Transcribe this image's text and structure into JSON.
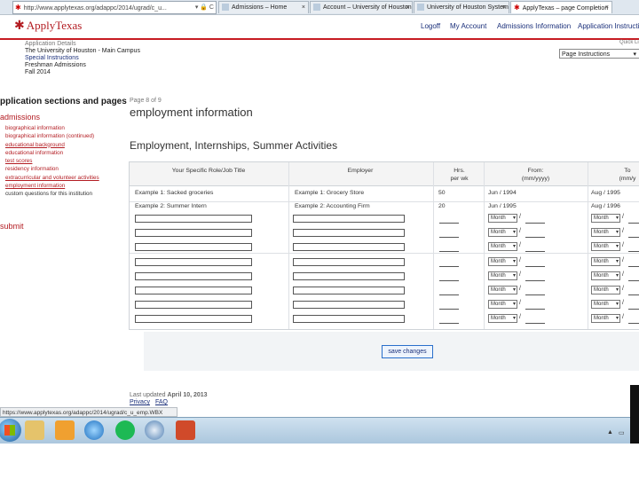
{
  "browser": {
    "address": "http://www.applytexas.org/adappc/2014/ugrad/c_u...",
    "tabs": [
      {
        "label": "Admissions – Home"
      },
      {
        "label": "Account – University of Houston"
      },
      {
        "label": "University of Houston System"
      },
      {
        "label": "ApplyTexas – page Completion"
      }
    ],
    "close": "×"
  },
  "header": {
    "logo": "ApplyTexas",
    "nav": [
      "Logoff",
      "My Account",
      "Admissions Information",
      "Application Instructions"
    ]
  },
  "quick_links": {
    "label": "Quick Li",
    "selected": "Page Instructions"
  },
  "application_details": {
    "label": "Application Details",
    "institution": "The University of Houston - Main Campus",
    "special": "Special Instructions",
    "type": "Freshman Admissions",
    "term": "Fall 2014"
  },
  "sidebar": {
    "heading": "pplication sections and pages",
    "admissions": "admissions",
    "items": [
      {
        "label": "biographical information"
      },
      {
        "label": "biographical information (continued)"
      },
      {
        "label": "educational background"
      },
      {
        "label": "educational information"
      },
      {
        "label": "test scores"
      },
      {
        "label": "residency information"
      },
      {
        "label": "extracurricular and volunteer activities"
      },
      {
        "label": "employment information"
      },
      {
        "label": "custom questions for this institution"
      }
    ],
    "submit": "submit"
  },
  "main": {
    "page_of": "Page 8 of 9",
    "title": "employment information",
    "section_title": "Employment, Internships, Summer Activities",
    "columns": {
      "role": "Your Specific Role/Job Title",
      "employer": "Employer",
      "hrs_1": "Hrs.",
      "hrs_2": "per wk",
      "from_1": "From:",
      "from_2": "(mm/yyyy)",
      "to_1": "To",
      "to_2": "(mm/y"
    },
    "examples": [
      {
        "role": "Example 1: Sacked groceries",
        "employer": "Example 1: Grocery Store",
        "hours": "50",
        "from": "Jun / 1994",
        "to": "Aug / 1995"
      },
      {
        "role": "Example 2: Summer Intern",
        "employer": "Example 2: Accounting Firm",
        "hours": "20",
        "from": "Jun / 1995",
        "to": "Aug / 1996"
      }
    ],
    "month_placeholder": "Month",
    "slash": "/",
    "save_label": "save changes",
    "last_updated_label": "Last updated",
    "last_updated_date": "April 10, 2013",
    "footer_links": [
      "Privacy",
      "FAQ"
    ]
  },
  "status_bar": "https://www.applytexas.org/adappc/2014/ugrad/c_u_emp.WBX",
  "colors": {
    "brand_red": "#b31c22",
    "link_blue": "#1a2f7a"
  }
}
